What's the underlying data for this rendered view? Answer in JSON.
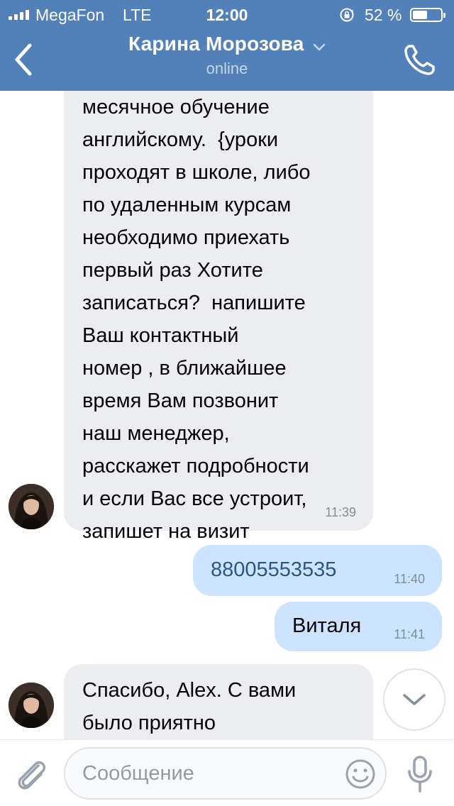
{
  "status_bar": {
    "carrier": "MegaFon",
    "network": "LTE",
    "time": "12:00",
    "battery_pct": "52 %",
    "battery_level": 0.52
  },
  "header": {
    "contact_name": "Карина Морозова",
    "contact_status": "online",
    "icons": [
      "back-arrow",
      "chevron-down",
      "phone"
    ]
  },
  "messages": [
    {
      "direction": "incoming",
      "text": "месячное обучение\nанглийскому.  {уроки\nпроходят в школе, либо\nпо удаленным курсам\nнеобходимо приехать\nпервый раз Хотите\nзаписаться?  напишите\nВаш контактный\nномер , в ближайшее\nвремя Вам позвонит\nнаш менеджер,\nрасскажет подробности\nи если Вас все устроит,\nзапишет на визит",
      "time": "11:39"
    },
    {
      "direction": "outgoing",
      "text": "88005553535",
      "time": "11:40"
    },
    {
      "direction": "outgoing",
      "text": "Виталя",
      "time": "11:41"
    },
    {
      "direction": "incoming",
      "text": "Спасибо, Alex. С вами\nбыло приятно",
      "time": ""
    }
  ],
  "composer": {
    "placeholder": "Сообщение",
    "icons": [
      "paperclip",
      "emoji",
      "microphone"
    ]
  },
  "colors": {
    "header_bg": "#5181b8",
    "incoming_bubble": "#ebedf0",
    "outgoing_bubble": "#cce4ff",
    "link_text": "#2a5885"
  }
}
